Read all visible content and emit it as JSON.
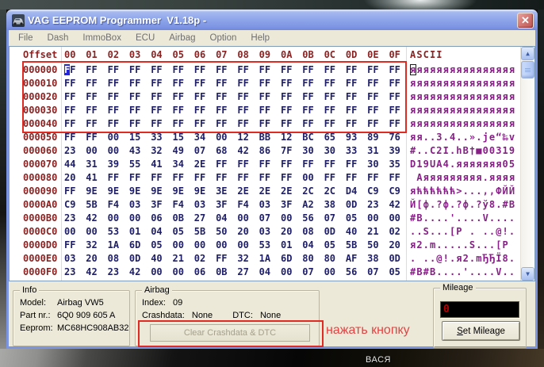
{
  "window": {
    "title": "VAG EEPROM Programmer  V1.18p -",
    "close_glyph": "✕"
  },
  "menu": {
    "items": [
      "File",
      "Dash",
      "ImmoBox",
      "ECU",
      "Airbag",
      "Option",
      "Help"
    ]
  },
  "hex_view": {
    "offset_header": "Offset",
    "byte_headers": [
      "00",
      "01",
      "02",
      "03",
      "04",
      "05",
      "06",
      "07",
      "08",
      "09",
      "0A",
      "0B",
      "0C",
      "0D",
      "0E",
      "0F"
    ],
    "ascii_header": "ASCII",
    "scrollbar_up": "▲",
    "scrollbar_down": "▼",
    "cursor": {
      "row": 0,
      "byte": 0,
      "ascii_box": true
    },
    "rows": [
      {
        "offset": "000000",
        "bytes": [
          "FF",
          "FF",
          "FF",
          "FF",
          "FF",
          "FF",
          "FF",
          "FF",
          "FF",
          "FF",
          "FF",
          "FF",
          "FF",
          "FF",
          "FF",
          "FF"
        ],
        "ascii": "яяяяяяяяяяяяяяяя"
      },
      {
        "offset": "000010",
        "bytes": [
          "FF",
          "FF",
          "FF",
          "FF",
          "FF",
          "FF",
          "FF",
          "FF",
          "FF",
          "FF",
          "FF",
          "FF",
          "FF",
          "FF",
          "FF",
          "FF"
        ],
        "ascii": "яяяяяяяяяяяяяяяя"
      },
      {
        "offset": "000020",
        "bytes": [
          "FF",
          "FF",
          "FF",
          "FF",
          "FF",
          "FF",
          "FF",
          "FF",
          "FF",
          "FF",
          "FF",
          "FF",
          "FF",
          "FF",
          "FF",
          "FF"
        ],
        "ascii": "яяяяяяяяяяяяяяяя"
      },
      {
        "offset": "000030",
        "bytes": [
          "FF",
          "FF",
          "FF",
          "FF",
          "FF",
          "FF",
          "FF",
          "FF",
          "FF",
          "FF",
          "FF",
          "FF",
          "FF",
          "FF",
          "FF",
          "FF"
        ],
        "ascii": "яяяяяяяяяяяяяяяя"
      },
      {
        "offset": "000040",
        "bytes": [
          "FF",
          "FF",
          "FF",
          "FF",
          "FF",
          "FF",
          "FF",
          "FF",
          "FF",
          "FF",
          "FF",
          "FF",
          "FF",
          "FF",
          "FF",
          "FF"
        ],
        "ascii": "яяяяяяяяяяяяяяяя"
      },
      {
        "offset": "000050",
        "bytes": [
          "FF",
          "FF",
          "00",
          "15",
          "33",
          "15",
          "34",
          "00",
          "12",
          "BB",
          "12",
          "BC",
          "65",
          "93",
          "89",
          "76"
        ],
        "ascii": "яя..3.4..».јe“‰v"
      },
      {
        "offset": "000060",
        "bytes": [
          "23",
          "00",
          "00",
          "43",
          "32",
          "49",
          "07",
          "68",
          "42",
          "86",
          "7F",
          "30",
          "30",
          "33",
          "31",
          "39"
        ],
        "ascii": "#..C2I.hB†■00319"
      },
      {
        "offset": "000070",
        "bytes": [
          "44",
          "31",
          "39",
          "55",
          "41",
          "34",
          "2E",
          "FF",
          "FF",
          "FF",
          "FF",
          "FF",
          "FF",
          "FF",
          "30",
          "35"
        ],
        "ascii": "D19UA4.яяяяяяя05"
      },
      {
        "offset": "000080",
        "bytes": [
          "20",
          "41",
          "FF",
          "FF",
          "FF",
          "FF",
          "FF",
          "FF",
          "FF",
          "FF",
          "FF",
          "00",
          "FF",
          "FF",
          "FF",
          "FF"
        ],
        "ascii": " Aяяяяяяяяя.яяяя"
      },
      {
        "offset": "000090",
        "bytes": [
          "FF",
          "9E",
          "9E",
          "9E",
          "9E",
          "9E",
          "9E",
          "3E",
          "2E",
          "2E",
          "2E",
          "2C",
          "2C",
          "D4",
          "C9",
          "C9"
        ],
        "ascii": "яћћћћћћ>...,,ФЙЙ"
      },
      {
        "offset": "0000A0",
        "bytes": [
          "C9",
          "5B",
          "F4",
          "03",
          "3F",
          "F4",
          "03",
          "3F",
          "F4",
          "03",
          "3F",
          "A2",
          "38",
          "0D",
          "23",
          "42"
        ],
        "ascii": "Й[ф.?ф.?ф.?ў8.#B"
      },
      {
        "offset": "0000B0",
        "bytes": [
          "23",
          "42",
          "00",
          "00",
          "06",
          "0B",
          "27",
          "04",
          "00",
          "07",
          "00",
          "56",
          "07",
          "05",
          "00",
          "00"
        ],
        "ascii": "#B....'....V...."
      },
      {
        "offset": "0000C0",
        "bytes": [
          "00",
          "00",
          "53",
          "01",
          "04",
          "05",
          "5B",
          "50",
          "20",
          "03",
          "20",
          "08",
          "0D",
          "40",
          "21",
          "02"
        ],
        "ascii": "..S...[P . ..@!."
      },
      {
        "offset": "0000D0",
        "bytes": [
          "FF",
          "32",
          "1A",
          "6D",
          "05",
          "00",
          "00",
          "00",
          "00",
          "53",
          "01",
          "04",
          "05",
          "5B",
          "50",
          "20"
        ],
        "ascii": "я2.m.....S...[P "
      },
      {
        "offset": "0000E0",
        "bytes": [
          "03",
          "20",
          "08",
          "0D",
          "40",
          "21",
          "02",
          "FF",
          "32",
          "1A",
          "6D",
          "80",
          "80",
          "AF",
          "38",
          "0D"
        ],
        "ascii": ". ..@!.я2.mЂЂЇ8."
      },
      {
        "offset": "0000F0",
        "bytes": [
          "23",
          "42",
          "23",
          "42",
          "00",
          "00",
          "06",
          "0B",
          "27",
          "04",
          "00",
          "07",
          "00",
          "56",
          "07",
          "05"
        ],
        "ascii": "#B#B....'....V.."
      }
    ]
  },
  "info_panel": {
    "title": "Info",
    "model_label": "Model:",
    "model": "Airbag VW5",
    "part_label": "Part nr.:",
    "part": "6Q0 909 605 A",
    "eeprom_label": "Eeprom:",
    "eeprom": "MC68HC908AB32"
  },
  "airbag_panel": {
    "title": "Airbag",
    "index_label": "Index:",
    "index": "09",
    "crashdata_label": "Crashdata:",
    "crashdata": "None",
    "dtc_label": "DTC:",
    "dtc": "None",
    "clear_button": "Clear Crashdata & DTC"
  },
  "mileage_panel": {
    "title": "Mileage",
    "value": "0",
    "set_button_accel": "S",
    "set_button_rest": "et Mileage"
  },
  "annotations": {
    "note": "нажать кнопку"
  },
  "desktop": {
    "label": "ВАСЯ"
  },
  "colors": {
    "annotation_red": "#df2b22",
    "offset_red": "#8b2323",
    "hex_navy": "#20206a",
    "ascii_purple": "#871f87",
    "cursor_blue": "#2525d8",
    "client_beige": "#ece9d8",
    "lcd_red": "#b40000"
  }
}
